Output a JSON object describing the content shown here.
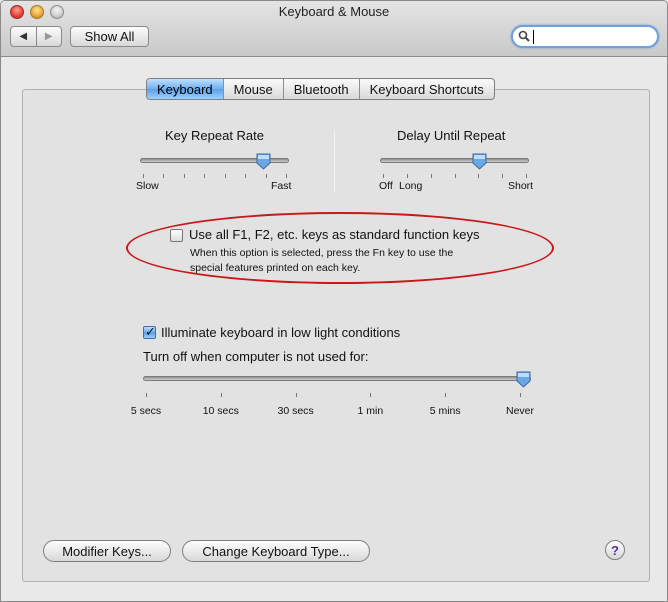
{
  "window": {
    "title": "Keyboard & Mouse"
  },
  "toolbar": {
    "back_glyph": "◀",
    "forward_glyph": "▶",
    "show_all": "Show All",
    "search_value": ""
  },
  "tabs": [
    {
      "label": "Keyboard",
      "active": true
    },
    {
      "label": "Mouse",
      "active": false
    },
    {
      "label": "Bluetooth",
      "active": false
    },
    {
      "label": "Keyboard Shortcuts",
      "active": false
    }
  ],
  "key_repeat": {
    "title": "Key Repeat Rate",
    "min_label": "Slow",
    "max_label": "Fast",
    "level": 0.83
  },
  "delay_repeat": {
    "title": "Delay Until Repeat",
    "labels": [
      "Off",
      "Long",
      "Short"
    ],
    "level": 0.67
  },
  "function_keys": {
    "label": "Use all F1, F2, etc. keys as standard function keys",
    "description_line1": "When this option is selected, press the Fn key to use the",
    "description_line2": "special features printed on each key.",
    "checked": false
  },
  "illuminate": {
    "label": "Illuminate keyboard in low light conditions",
    "checked": true,
    "turn_off_label": "Turn off when computer is not used for:",
    "options": [
      "5 secs",
      "10 secs",
      "30 secs",
      "1 min",
      "5 mins",
      "Never"
    ],
    "selected": "Never"
  },
  "buttons": {
    "modifier_keys": "Modifier Keys...",
    "change_keyboard_type": "Change Keyboard Type...",
    "help": "?"
  },
  "colors": {
    "accent": "#5aa0e8",
    "highlight_ellipse": "#c8181a"
  }
}
